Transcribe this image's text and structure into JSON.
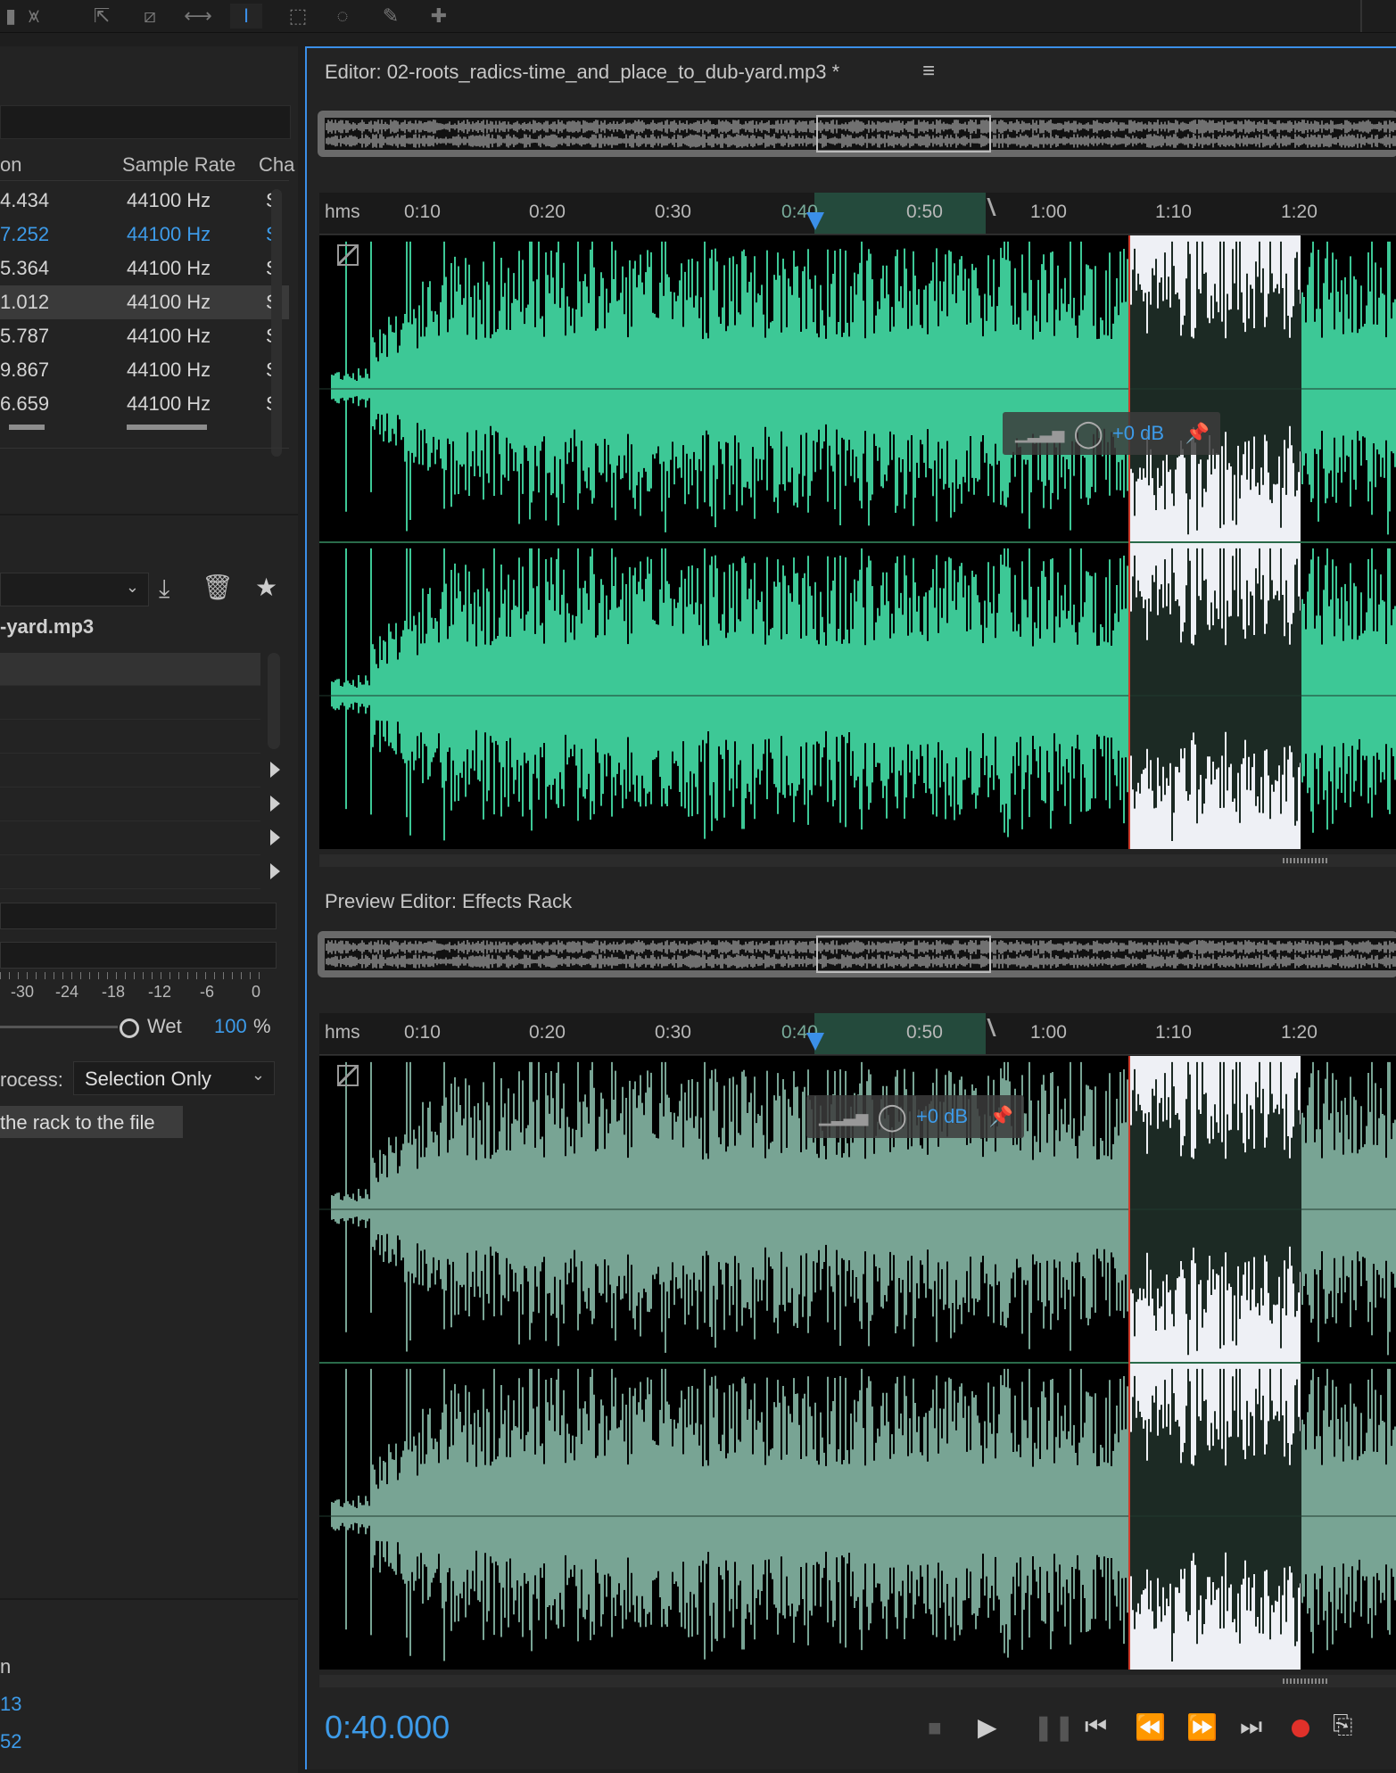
{
  "toolbar": {
    "tools": [
      "waveform-view-icon",
      "spectral-view-icon",
      "move-tool-icon",
      "razor-tool-icon",
      "slip-tool-icon",
      "time-selection-tool-icon",
      "marquee-tool-icon",
      "lasso-tool-icon",
      "brush-tool-icon",
      "spot-healing-tool-icon"
    ]
  },
  "files_panel": {
    "columns": [
      "on",
      "Sample Rate",
      "Cha"
    ],
    "rows": [
      {
        "duration": "4.434",
        "rate": "44100 Hz",
        "ch": "S"
      },
      {
        "duration": "7.252",
        "rate": "44100 Hz",
        "ch": "S"
      },
      {
        "duration": "5.364",
        "rate": "44100 Hz",
        "ch": "S"
      },
      {
        "duration": "1.012",
        "rate": "44100 Hz",
        "ch": "S"
      },
      {
        "duration": "5.787",
        "rate": "44100 Hz",
        "ch": "S"
      },
      {
        "duration": "9.867",
        "rate": "44100 Hz",
        "ch": "S"
      },
      {
        "duration": "6.659",
        "rate": "44100 Hz",
        "ch": "S"
      }
    ]
  },
  "effects_rack": {
    "file_label": "-yard.mp3",
    "meter_ticks": [
      "-30",
      "-24",
      "-18",
      "-12",
      "-6",
      "0"
    ],
    "wet_label": "Wet",
    "wet_value": "100",
    "wet_unit": "%",
    "process_label": "rocess:",
    "process_value": "Selection Only",
    "apply_label": "the rack to the file"
  },
  "bottom_left": {
    "label": "n",
    "value1": "13",
    "value2": "52"
  },
  "editor": {
    "title": "Editor: 02-roots_radics-time_and_place_to_dub-yard.mp3 *",
    "ruler_unit": "hms",
    "ruler_ticks": [
      "0:10",
      "0:20",
      "0:30",
      "0:40",
      "0:50",
      "1:00",
      "1:10",
      "1:20"
    ],
    "hud_gain": "+0 dB"
  },
  "preview": {
    "title": "Preview Editor: Effects Rack",
    "hud_gain": "+0 dB"
  },
  "transport": {
    "time": "0:40.000"
  },
  "colors": {
    "accent": "#3b8fe8",
    "waveform_main": "#3dc896",
    "waveform_preview": "#78a494",
    "selection": "#eef0f5",
    "playhead": "#d03a2a",
    "record": "#e0312a"
  }
}
